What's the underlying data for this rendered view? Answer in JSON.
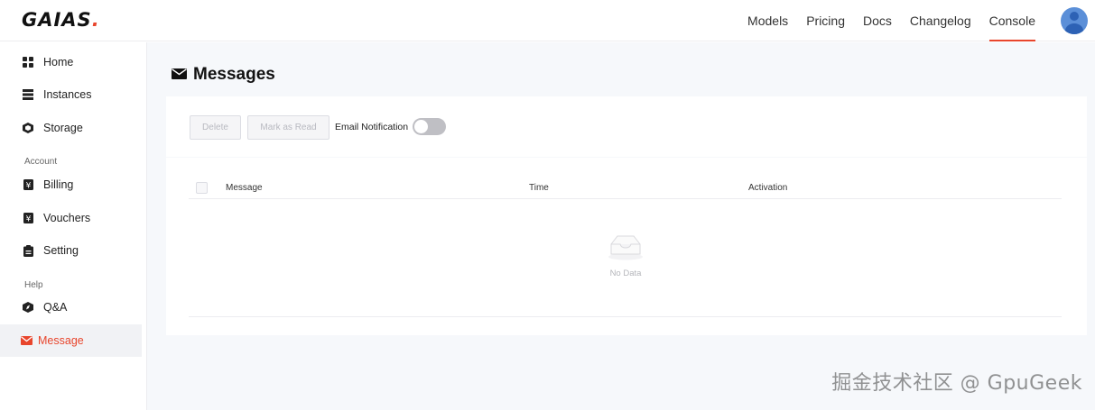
{
  "brand": {
    "name": "GAIAS",
    "dot": "."
  },
  "topnav": {
    "items": [
      {
        "label": "Models"
      },
      {
        "label": "Pricing"
      },
      {
        "label": "Docs"
      },
      {
        "label": "Changelog"
      },
      {
        "label": "Console",
        "active": true
      }
    ]
  },
  "sidebar": {
    "items": [
      {
        "label": "Home",
        "icon": "grid-icon"
      },
      {
        "label": "Instances",
        "icon": "server-icon"
      },
      {
        "label": "Storage",
        "icon": "cube-icon"
      }
    ],
    "account_group": "Account",
    "account_items": [
      {
        "label": "Billing",
        "icon": "yen-icon"
      },
      {
        "label": "Vouchers",
        "icon": "voucher-icon"
      },
      {
        "label": "Setting",
        "icon": "clipboard-icon"
      }
    ],
    "help_group": "Help",
    "help_items": [
      {
        "label": "Q&A",
        "icon": "compass-icon"
      },
      {
        "label": "Message",
        "icon": "envelope-icon",
        "active": true
      }
    ]
  },
  "page": {
    "title": "Messages",
    "title_icon": "envelope-icon"
  },
  "toolbar": {
    "delete_label": "Delete",
    "mark_read_label": "Mark as Read",
    "email_notification_label": "Email Notification",
    "email_notification_on": false
  },
  "table": {
    "columns": [
      "Message",
      "Time",
      "Activation"
    ],
    "empty_text": "No Data"
  },
  "watermark": "掘金技术社区 @ GpuGeek",
  "colors": {
    "accent": "#e8452c",
    "background": "#f6f8fb"
  }
}
